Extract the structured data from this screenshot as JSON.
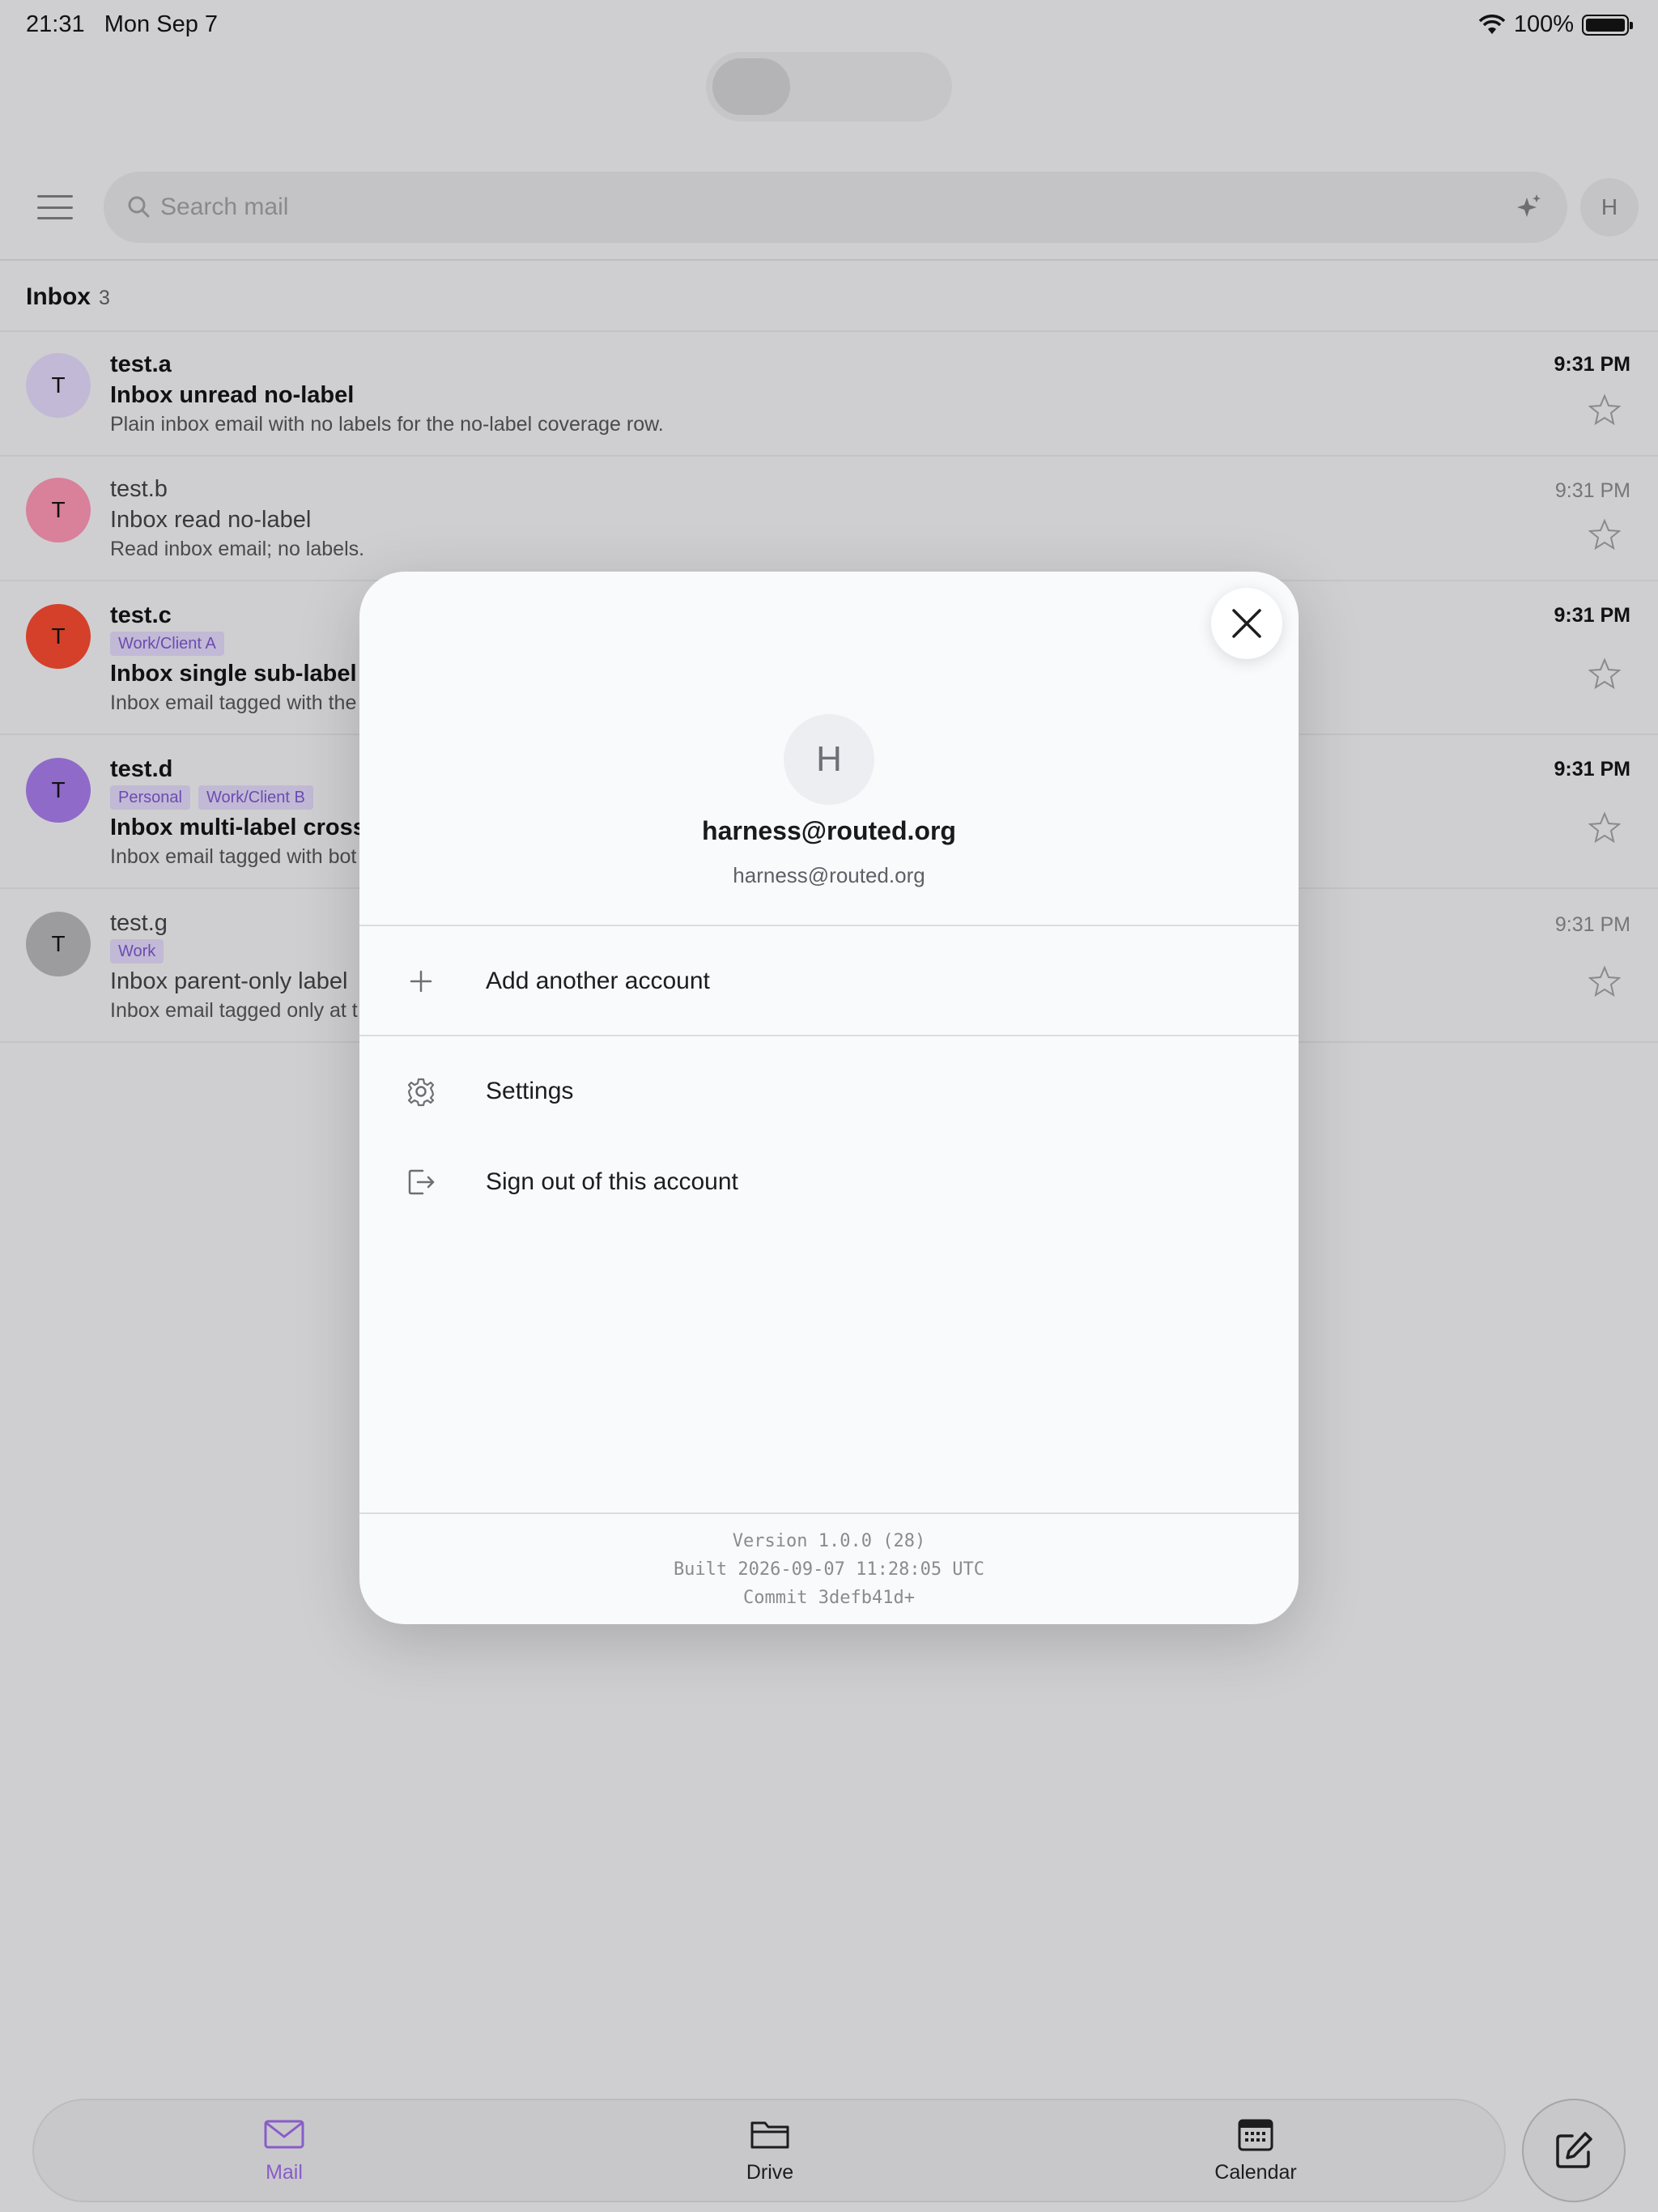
{
  "status_bar": {
    "time": "21:31",
    "date": "Mon Sep 7",
    "battery": "100%"
  },
  "search": {
    "placeholder": "Search mail"
  },
  "account_button": {
    "initial": "H"
  },
  "inbox": {
    "title": "Inbox",
    "count": "3"
  },
  "emails": [
    {
      "avatar": "T",
      "avatar_color": "#c2b9d6",
      "sender": "test.a",
      "labels": [],
      "subject": "Inbox unread no-label",
      "preview": "Plain inbox email with no labels for the no-label coverage row.",
      "time": "9:31 PM",
      "unread": true
    },
    {
      "avatar": "T",
      "avatar_color": "#d9809a",
      "sender": "test.b",
      "labels": [],
      "subject": "Inbox read no-label",
      "preview": "Read inbox email; no labels.",
      "time": "9:31 PM",
      "unread": false
    },
    {
      "avatar": "T",
      "avatar_color": "#d4402a",
      "sender": "test.c",
      "labels": [
        "Work/Client A"
      ],
      "subject": "Inbox single sub-label",
      "preview": "Inbox email tagged with the",
      "time": "9:31 PM",
      "unread": true
    },
    {
      "avatar": "T",
      "avatar_color": "#8f6ac9",
      "sender": "test.d",
      "labels": [
        "Personal",
        "Work/Client B"
      ],
      "subject": "Inbox multi-label cross",
      "preview": "Inbox email tagged with bot",
      "time": "9:31 PM",
      "unread": true
    },
    {
      "avatar": "T",
      "avatar_color": "#9c9c9f",
      "sender": "test.g",
      "labels": [
        "Work"
      ],
      "subject": "Inbox parent-only label",
      "preview": "Inbox email tagged only at t",
      "time": "9:31 PM",
      "unread": false
    }
  ],
  "tabs": {
    "mail": "Mail",
    "drive": "Drive",
    "calendar": "Calendar"
  },
  "colors": {
    "accent": "#8a5cc9",
    "chip_text": "#6a4cb0"
  },
  "modal": {
    "avatar_initial": "H",
    "display_name": "harness@routed.org",
    "email": "harness@routed.org",
    "add_account": "Add another account",
    "settings": "Settings",
    "sign_out": "Sign out of this account",
    "version": "Version 1.0.0 (28)",
    "built": "Built 2026-09-07 11:28:05 UTC",
    "commit": "Commit 3defb41d+"
  }
}
